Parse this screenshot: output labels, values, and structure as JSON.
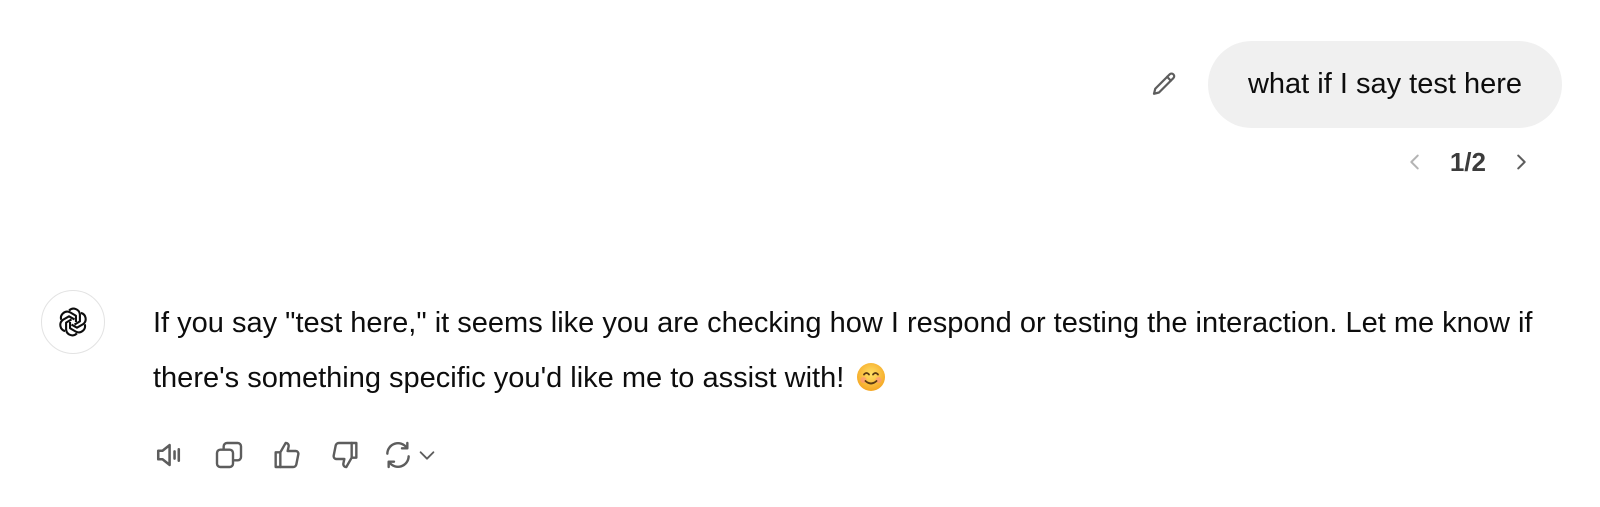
{
  "user_message": {
    "text": "what if I say test here",
    "edit_icon": "pencil-icon",
    "branch_indicator": "1/2",
    "prev_icon": "chevron-left-icon",
    "next_icon": "chevron-right-icon"
  },
  "assistant_message": {
    "avatar_icon": "openai-logo-icon",
    "text": "If you say \"test here,\" it seems like you are checking how I respond or testing the interaction. Let me know if there's something specific you'd like me to assist with!",
    "emoji": "smiling-face-emoji",
    "actions": [
      {
        "name": "read-aloud",
        "icon": "speaker-icon"
      },
      {
        "name": "copy",
        "icon": "copy-icon"
      },
      {
        "name": "good-response",
        "icon": "thumbs-up-icon"
      },
      {
        "name": "bad-response",
        "icon": "thumbs-down-icon"
      },
      {
        "name": "regenerate",
        "icon": "refresh-icon"
      }
    ]
  },
  "colors": {
    "bubble_bg": "#f0f0f0",
    "icon_gray": "#5d5d5d",
    "text": "#0d0d0d"
  }
}
